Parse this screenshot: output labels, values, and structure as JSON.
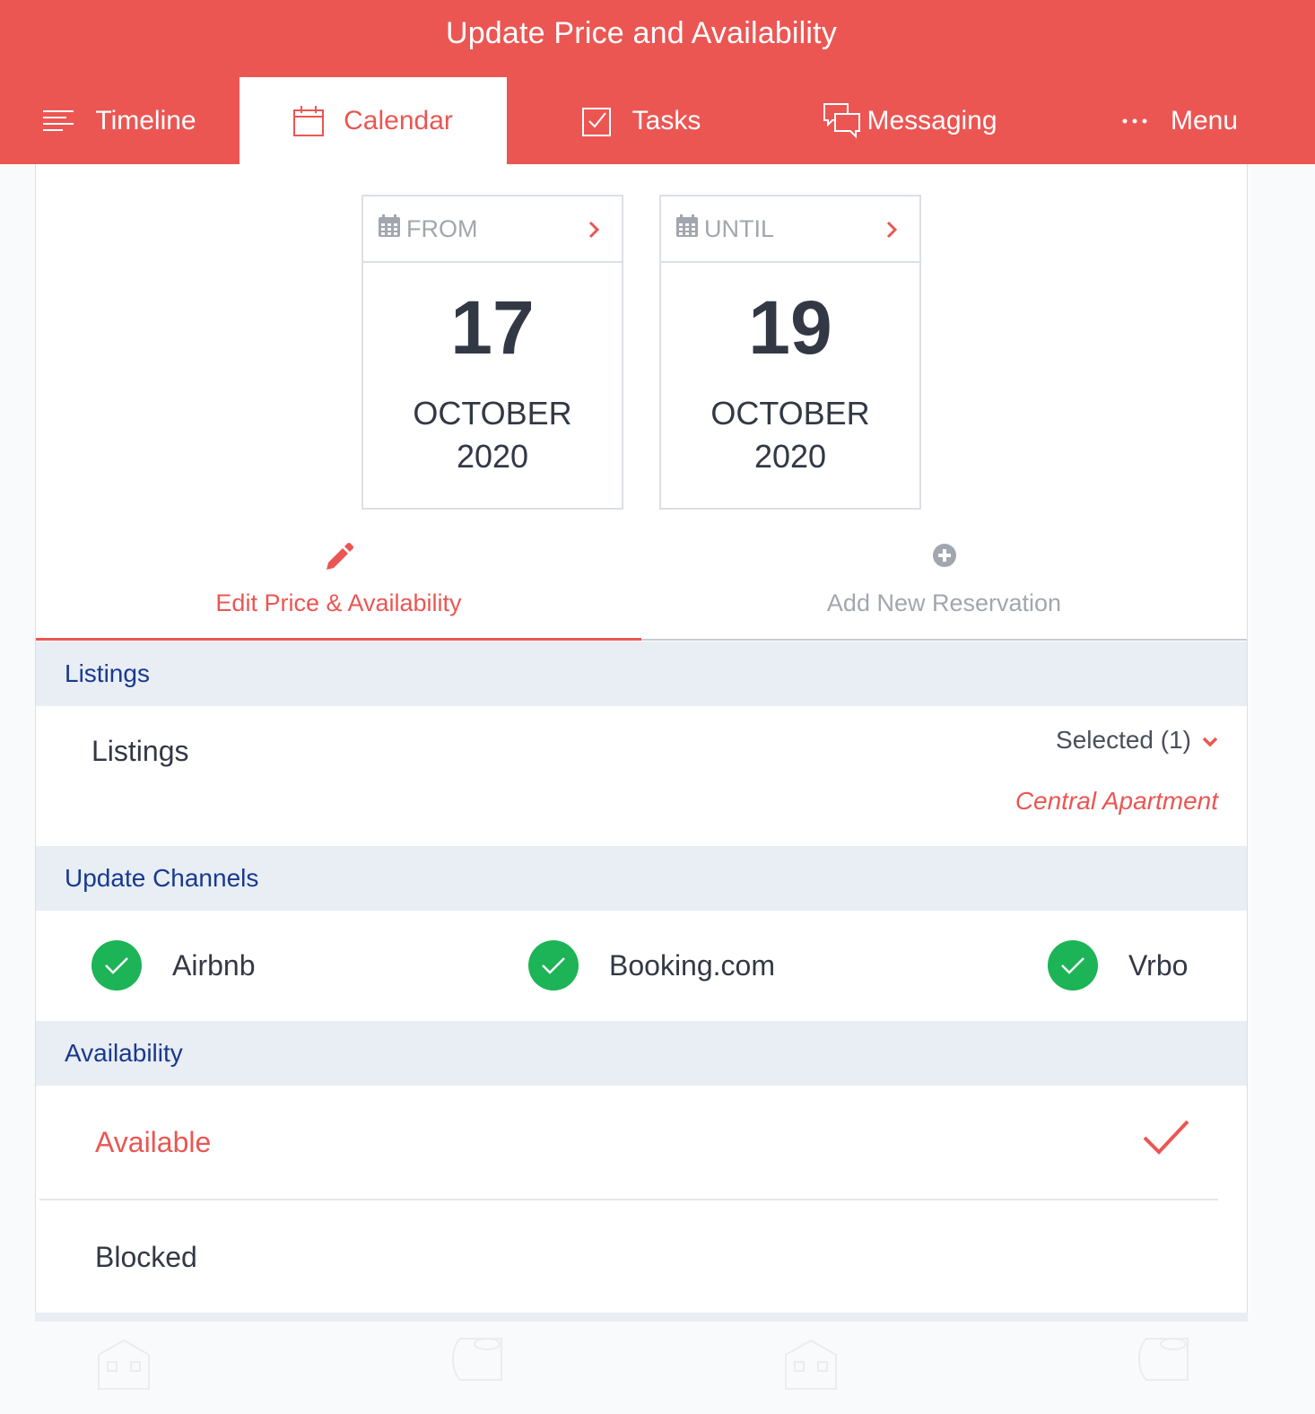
{
  "header": {
    "title": "Update Price and Availability",
    "tabs": [
      {
        "label": "Timeline",
        "icon": "timeline-icon",
        "active": false
      },
      {
        "label": "Calendar",
        "icon": "calendar-icon",
        "active": true
      },
      {
        "label": "Tasks",
        "icon": "tasks-icon",
        "active": false
      },
      {
        "label": "Messaging",
        "icon": "messaging-icon",
        "active": false
      },
      {
        "label": "Menu",
        "icon": "more-dots-icon",
        "active": false
      }
    ]
  },
  "date_range": {
    "from": {
      "label": "FROM",
      "day": "17",
      "month": "OCTOBER",
      "year": "2020"
    },
    "until": {
      "label": "UNTIL",
      "day": "19",
      "month": "OCTOBER",
      "year": "2020"
    }
  },
  "actions": {
    "edit_label": "Edit Price & Availability",
    "add_label": "Add New Reservation"
  },
  "listings": {
    "section_title": "Listings",
    "row_label": "Listings",
    "selected_text": "Selected (1)",
    "selected_listing": "Central Apartment"
  },
  "channels": {
    "section_title": "Update Channels",
    "items": [
      {
        "name": "Airbnb",
        "checked": true
      },
      {
        "name": "Booking.com",
        "checked": true
      },
      {
        "name": "Vrbo",
        "checked": true
      }
    ]
  },
  "availability": {
    "section_title": "Availability",
    "options": [
      {
        "label": "Available",
        "selected": true
      },
      {
        "label": "Blocked",
        "selected": false
      }
    ]
  },
  "colors": {
    "brand": "#eb5653",
    "section_heading": "#173a8f",
    "check_green": "#1cb456"
  }
}
